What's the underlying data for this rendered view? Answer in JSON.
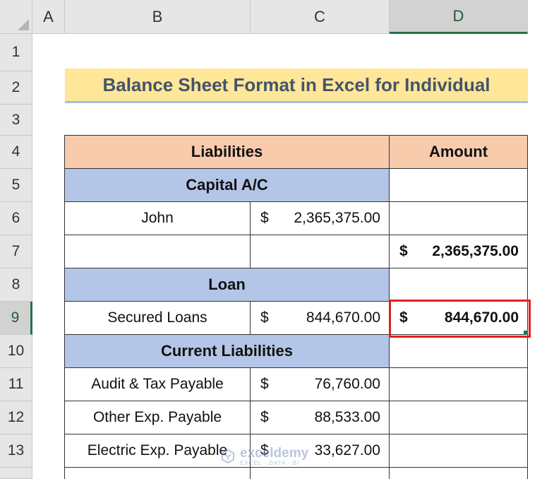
{
  "columns": [
    "A",
    "B",
    "C",
    "D"
  ],
  "selected_column": "D",
  "rows": [
    "1",
    "2",
    "3",
    "4",
    "5",
    "6",
    "7",
    "8",
    "9",
    "10",
    "11",
    "12",
    "13"
  ],
  "selected_row": "9",
  "title": "Balance Sheet Format in Excel for Individual",
  "table": {
    "header": {
      "liabilities": "Liabilities",
      "amount": "Amount"
    },
    "capital": {
      "label": "Capital A/C",
      "john": {
        "name": "John",
        "currency": "$",
        "value": "2,365,375.00"
      },
      "total": {
        "currency": "$",
        "value": "2,365,375.00"
      }
    },
    "loan": {
      "label": "Loan",
      "secured": {
        "name": "Secured Loans",
        "currency": "$",
        "value": "844,670.00"
      },
      "total": {
        "currency": "$",
        "value": "844,670.00"
      }
    },
    "current": {
      "label": "Current Liabilities",
      "items": [
        {
          "name": "Audit & Tax Payable",
          "currency": "$",
          "value": "76,760.00"
        },
        {
          "name": "Other Exp. Payable",
          "currency": "$",
          "value": "88,533.00"
        },
        {
          "name": "Electric Exp. Payable",
          "currency": "$",
          "value": "33,627.00"
        }
      ]
    }
  },
  "watermark": {
    "name": "exceldemy",
    "tagline": "EXCEL · DATA · BI"
  },
  "colors": {
    "title_bg": "#ffe699",
    "header_bg": "#f8cbad",
    "section_bg": "#b4c6e7",
    "selection": "#e02020",
    "excel_green": "#217346"
  }
}
